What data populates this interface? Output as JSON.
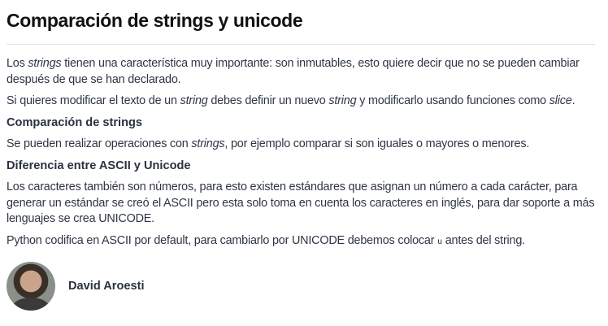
{
  "title": "Comparación de strings y unicode",
  "p1": {
    "a": "Los ",
    "b": "strings",
    "c": " tienen una característica muy importante: son inmutables, esto quiere decir que no se pueden cambiar después de que se han declarado."
  },
  "p2": {
    "a": "Si quieres modificar el texto de un ",
    "b": "string",
    "c": " debes definir un nuevo ",
    "d": "string",
    "e": " y modificarlo usando funciones como ",
    "f": "slice",
    "g": "."
  },
  "h1": "Comparación de strings",
  "p3": {
    "a": "Se pueden realizar operaciones con ",
    "b": "strings",
    "c": ", por ejemplo comparar si son iguales o mayores o menores."
  },
  "h2": "Diferencia entre ASCII y Unicode",
  "p4": "Los caracteres también son números, para esto existen estándares que asignan un número a cada carácter, para generar un estándar se creó el ASCII pero esta solo toma en cuenta los caracteres en inglés, para dar soporte a más lenguajes se crea UNICODE.",
  "p5": {
    "a": "Python codifica en ASCII por default, para cambiarlo por UNICODE debemos colocar ",
    "b": "u",
    "c": " antes del string."
  },
  "author": {
    "name": "David Aroesti"
  }
}
